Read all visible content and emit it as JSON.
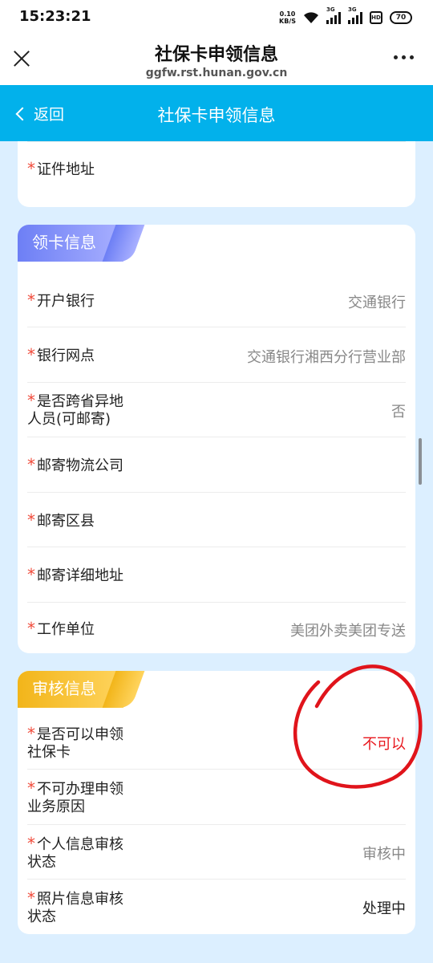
{
  "status_bar": {
    "time": "15:23:21",
    "net_speed_value": "0.10",
    "net_speed_unit": "KB/S",
    "signal1_label": "3G",
    "signal2_label": "3G",
    "mi_label": "HD",
    "battery": "70",
    "icons": [
      "wifi-icon",
      "signal-icon",
      "signal-icon",
      "hd-icon",
      "battery-icon"
    ]
  },
  "browser": {
    "title": "社保卡申领信息",
    "url": "ggfw.rst.hunan.gov.cn",
    "icons": [
      "close-icon",
      "more-icon"
    ]
  },
  "navbar": {
    "back_label": "返回",
    "title": "社保卡申领信息",
    "background": "#02b1eb"
  },
  "section_address": {
    "rows": [
      {
        "label": "证件地址",
        "value": ""
      }
    ]
  },
  "section_card": {
    "title": "领卡信息",
    "accent": "#7f8cf7",
    "rows": [
      {
        "label": "开户银行",
        "value": "交通银行"
      },
      {
        "label": "银行网点",
        "value": "交通银行湘西分行营业部"
      },
      {
        "label_line1": "是否跨省异地",
        "label_line2": "人员(可邮寄)",
        "value": "否"
      },
      {
        "label": "邮寄物流公司",
        "value": ""
      },
      {
        "label": "邮寄区县",
        "value": ""
      },
      {
        "label": "邮寄详细地址",
        "value": ""
      },
      {
        "label": "工作单位",
        "value": "美团外卖美团专送"
      }
    ]
  },
  "section_review": {
    "title": "审核信息",
    "accent": "#f5bd2a",
    "rows": [
      {
        "label_line1": "是否可以申领",
        "label_line2": "社保卡",
        "value": "不可以",
        "value_color": "#e8171d"
      },
      {
        "label_line1": "不可办理申领",
        "label_line2": "业务原因",
        "value": ""
      },
      {
        "label_line1": "个人信息审核",
        "label_line2": "状态",
        "value": "审核中"
      },
      {
        "label_line1": "照片信息审核",
        "label_line2": "状态",
        "value": "处理中"
      }
    ]
  },
  "required_mark": "*"
}
